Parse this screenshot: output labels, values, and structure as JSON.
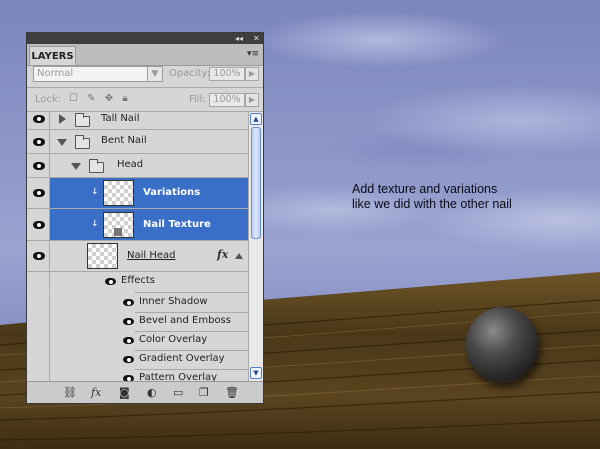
{
  "annotation": {
    "line1": "Add texture and variations",
    "line2": "like we did with the other nail"
  },
  "panel": {
    "tab_label": "LAYERS",
    "collapse_label": "◂◂",
    "close_label": "✕",
    "menu_label": "▾≡",
    "blend_mode": "Normal",
    "opacity_label": "Opacity:",
    "opacity_value": "100%",
    "lock_label": "Lock:",
    "fill_label": "Fill:",
    "fill_value": "100%"
  },
  "layers": {
    "tall_nail": "Tall Nail",
    "bent_nail": "Bent Nail",
    "head": "Head",
    "variations": "Variations",
    "nail_texture": "Nail Texture",
    "nail_head": "Nail Head",
    "fx_label": "fx",
    "effects": "Effects",
    "effect_items": [
      "Inner Shadow",
      "Bevel and Emboss",
      "Color Overlay",
      "Gradient Overlay",
      "Pattern Overlay"
    ]
  },
  "colors": {
    "selection": "#3a6fc7",
    "panel_bg": "#d6d6d6"
  },
  "icons": [
    "link-icon",
    "fx-icon",
    "mask-icon",
    "adjustment-icon",
    "folder-icon",
    "new-layer-icon",
    "trash-icon"
  ]
}
